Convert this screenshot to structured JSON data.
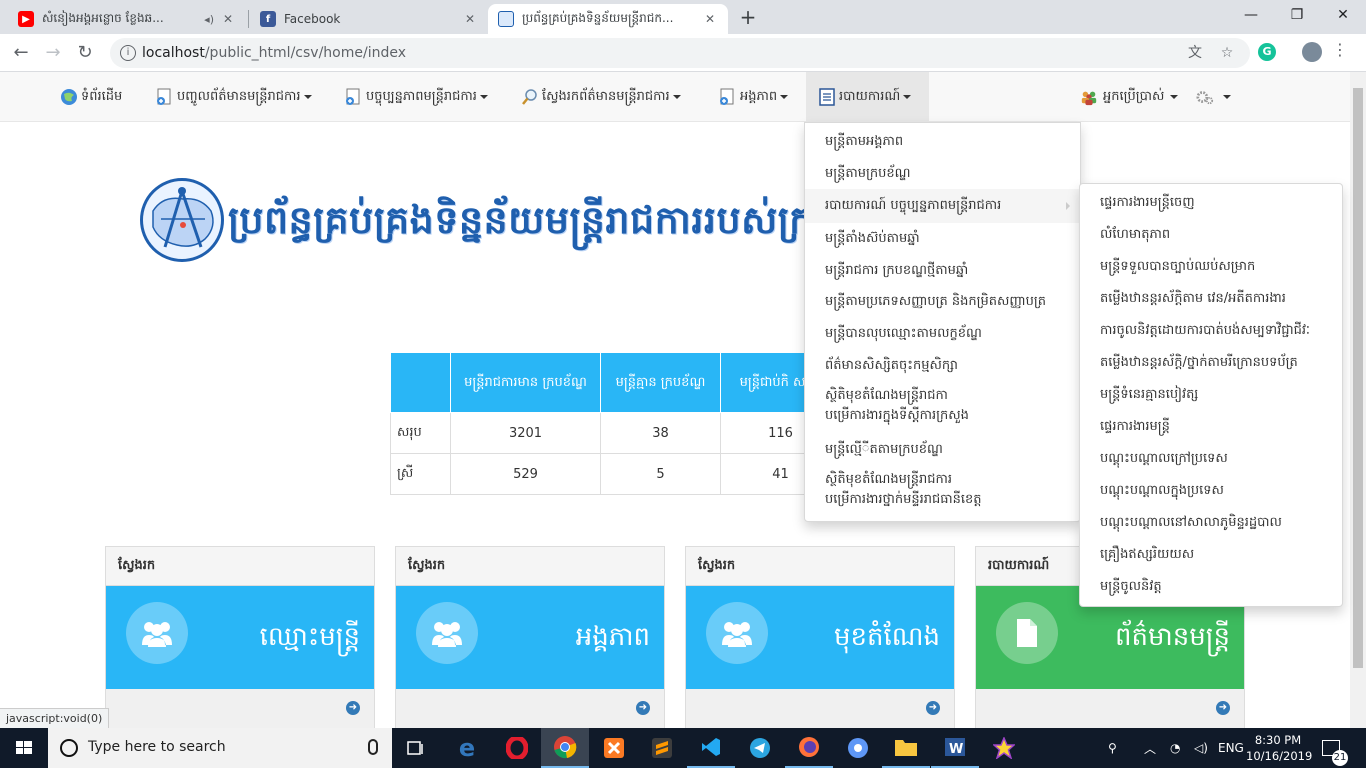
{
  "browser": {
    "tabs": [
      {
        "title": "សំនៀងអង្គអន្លោច ខ្លែងឆ...",
        "favicon": "youtube-icon",
        "color": "#ff0000",
        "active": false
      },
      {
        "title": "Facebook",
        "favicon": "facebook-icon",
        "color": "#3b5998",
        "active": false
      },
      {
        "title": "ប្រព័ន្ធគ្រប់គ្រងទិន្នន័យមន្ត្រីរាជក...",
        "favicon": "site-logo-icon",
        "color": "#1f5fae",
        "active": true
      }
    ],
    "new_tab_label": "+",
    "address": {
      "host": "localhost",
      "path": "/public_html/csv/home/index"
    }
  },
  "nav": {
    "home": "ទំព័រដើម",
    "input": "បញ្ចូលព័ត៌មានមន្ត្រីរាជការ",
    "status": "បច្ចុប្បន្នភាពមន្ត្រីរាជការ",
    "search": "ស្វែងរកព័ត៌មានមន្ត្រីរាជការ",
    "entity": "អង្គភាព",
    "report": "របាយការណ៍",
    "user": "អ្នកប្រើប្រាស់"
  },
  "site_title": "ប្រព័ន្ធគ្រប់គ្រងទិន្នន័យមន្ត្រីរាជការរបស់ក្រសួងរៀប",
  "stats": {
    "headers": [
      "",
      "មន្ត្រីរាជការមាន ក្របខ័ណ្ឌ",
      "មន្ត្រីគ្មាន ក្របខ័ណ្ឌ",
      "មន្ត្រីជាប់កិ សន្យា"
    ],
    "rows": [
      {
        "label": "សរុប",
        "values": [
          "3201",
          "38",
          "116"
        ]
      },
      {
        "label": "ស្រី",
        "values": [
          "529",
          "5",
          "41"
        ]
      }
    ]
  },
  "panels": [
    {
      "heading": "ស្វែងរក",
      "label": "ឈ្មោះមន្ត្រី",
      "icon": "users-icon",
      "color": "#29b6f6"
    },
    {
      "heading": "ស្វែងរក",
      "label": "អង្គភាព",
      "icon": "users-icon",
      "color": "#29b6f6"
    },
    {
      "heading": "ស្វែងរក",
      "label": "មុខតំណែង",
      "icon": "users-icon",
      "color": "#29b6f6"
    },
    {
      "heading": "របាយការណ៍",
      "label": "ព័ត៌មានមន្ត្រី",
      "icon": "document-icon",
      "color": "#3dbb5e"
    }
  ],
  "report_menu": [
    "មន្ត្រីតាមអង្គភាព",
    "មន្ត្រីតាមក្របខ័ណ្ឌ",
    "របាយការណ៍ បច្ចុប្បន្នភាពមន្ត្រីរាជការ",
    "មន្ត្រីតាំងស៊ប់តាមឆ្នាំ",
    "មន្ត្រីរាជការ ក្របខណ្ឌថ្មីតាមឆ្នាំ",
    "មន្ត្រីតាមប្រភេទសញ្ញាបត្រ និងកម្រិតសញ្ញាបត្រ",
    "មន្ត្រីបានលុបឈ្មោះតាមលក្ខខ័ណ្ឌ",
    "ព័ត៌មានសិស្សិតចុះកម្មសិក្សា",
    "ស្ថិតិមុខតំណែងមន្ត្រីរាជកា",
    "បម្រើការងារក្នុងទីស្តីការក្រសួង",
    "មន្ត្រីលើ្មីតតាមក្របខ័ណ្ឌ",
    "ស្ថិតិមុខតំណែងមន្ត្រីរាជការ",
    "បម្រើការងារថ្នាក់មន្ទីររាជធានីខេត្ត"
  ],
  "status_submenu": [
    "ផ្ទេរការងារមន្ត្រីចេញ",
    "លំហែមាតុភាព",
    "មន្ត្រីទទួលបានច្បាប់ឈប់សម្រាក",
    "តម្លើងឋានន្តរស័ក្តិតាម វេន/អតីតការងារ",
    "ការចូលនិវត្តដោយការបាត់បង់សម្បទាវិជ្ជាជីវៈ",
    "តម្លើងឋានន្តរស័ក្តិ/ថ្នាក់តាមរីក្រោនបទប័ត្រ",
    "មន្ត្រីទំនេរគ្មានបៀវត្ស",
    "ផ្ទេរការងារមន្ត្រី",
    "បណ្តុះបណ្តាលក្រៅប្រទេស",
    "បណ្តុះបណ្តាលក្នុងប្រទេស",
    "បណ្តុះបណ្តាលនៅសាលាភូមិន្ទរដ្ឋបាល",
    "គ្រឿងឥស្សរិយយស",
    "មន្ត្រីចូលនិវត្ត"
  ],
  "status_bar": "javascript:void(0)",
  "taskbar": {
    "search_placeholder": "Type here to search",
    "language": "ENG",
    "time": "8:30 PM",
    "date": "10/16/2019",
    "notifications": "21"
  }
}
